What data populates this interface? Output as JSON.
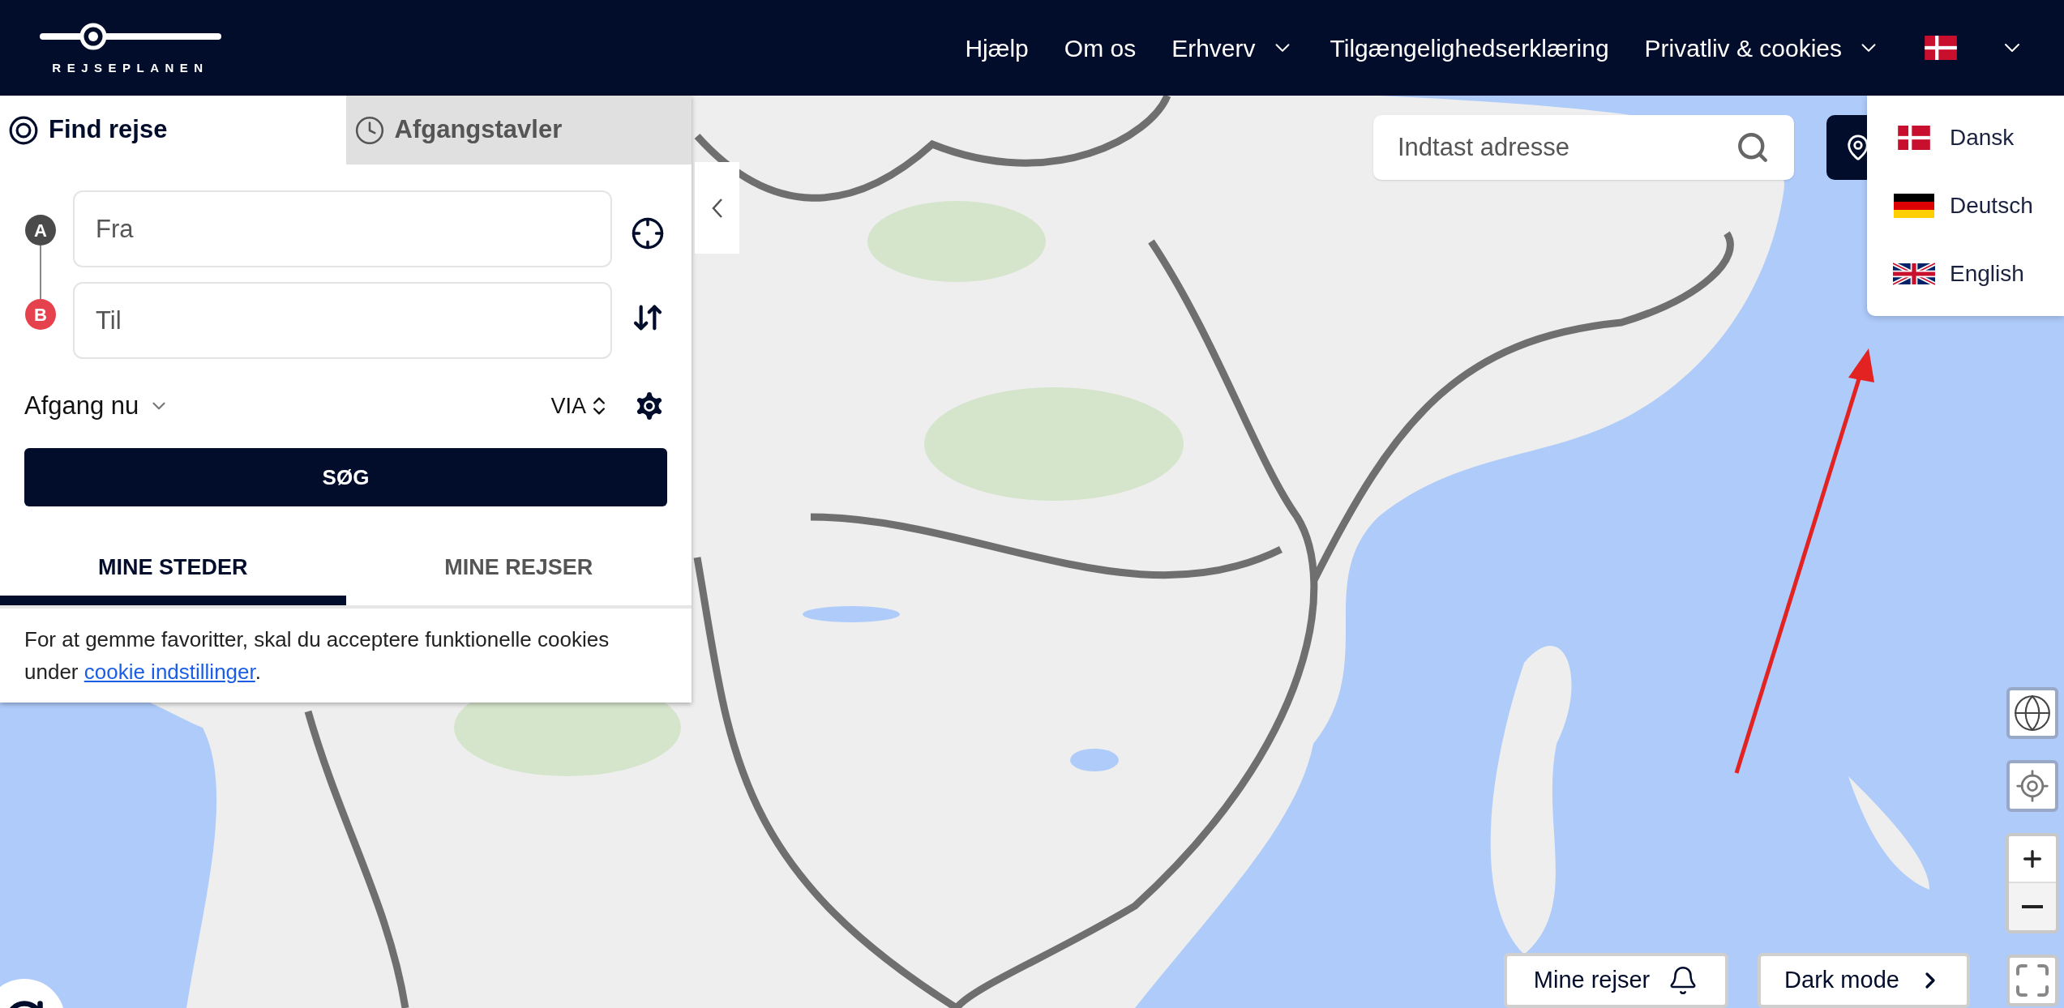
{
  "header": {
    "logo": "REJSEPLANEN",
    "nav": [
      {
        "label": "Hjælp",
        "has_menu": false
      },
      {
        "label": "Om os",
        "has_menu": false
      },
      {
        "label": "Erhverv",
        "has_menu": true
      },
      {
        "label": "Tilgængelighedserklæring",
        "has_menu": false
      },
      {
        "label": "Privatliv & cookies",
        "has_menu": true
      }
    ],
    "language": {
      "kind": "dk",
      "expanded": true
    }
  },
  "language_menu": [
    {
      "label": "Dansk",
      "kind": "dk"
    },
    {
      "label": "Deutsch",
      "kind": "de"
    },
    {
      "label": "English",
      "kind": "gb"
    }
  ],
  "panel": {
    "tabs": [
      {
        "label": "Find rejse",
        "kind": "target",
        "selected": true
      },
      {
        "label": "Afgangstavler",
        "kind": "clock",
        "selected": false
      }
    ],
    "from": {
      "marker": "A",
      "placeholder": "Fra"
    },
    "to": {
      "marker": "B",
      "placeholder": "Til"
    },
    "time": "Afgang nu",
    "via": "VIA",
    "search_button": "SØG",
    "list_tabs": [
      {
        "label": "MINE STEDER",
        "selected": true
      },
      {
        "label": "MINE REJSER",
        "selected": false
      }
    ],
    "notice": {
      "text": "For at gemme favoritter, skal du acceptere funktionelle cookies under",
      "link": "cookie indstillinger",
      "end": "."
    }
  },
  "map": {
    "search": {
      "placeholder": "Indtast adresse"
    },
    "buttons": [
      {
        "label": "Mine rejser",
        "kind": "bell"
      },
      {
        "label": "Dark mode",
        "kind": "chevron"
      }
    ]
  }
}
